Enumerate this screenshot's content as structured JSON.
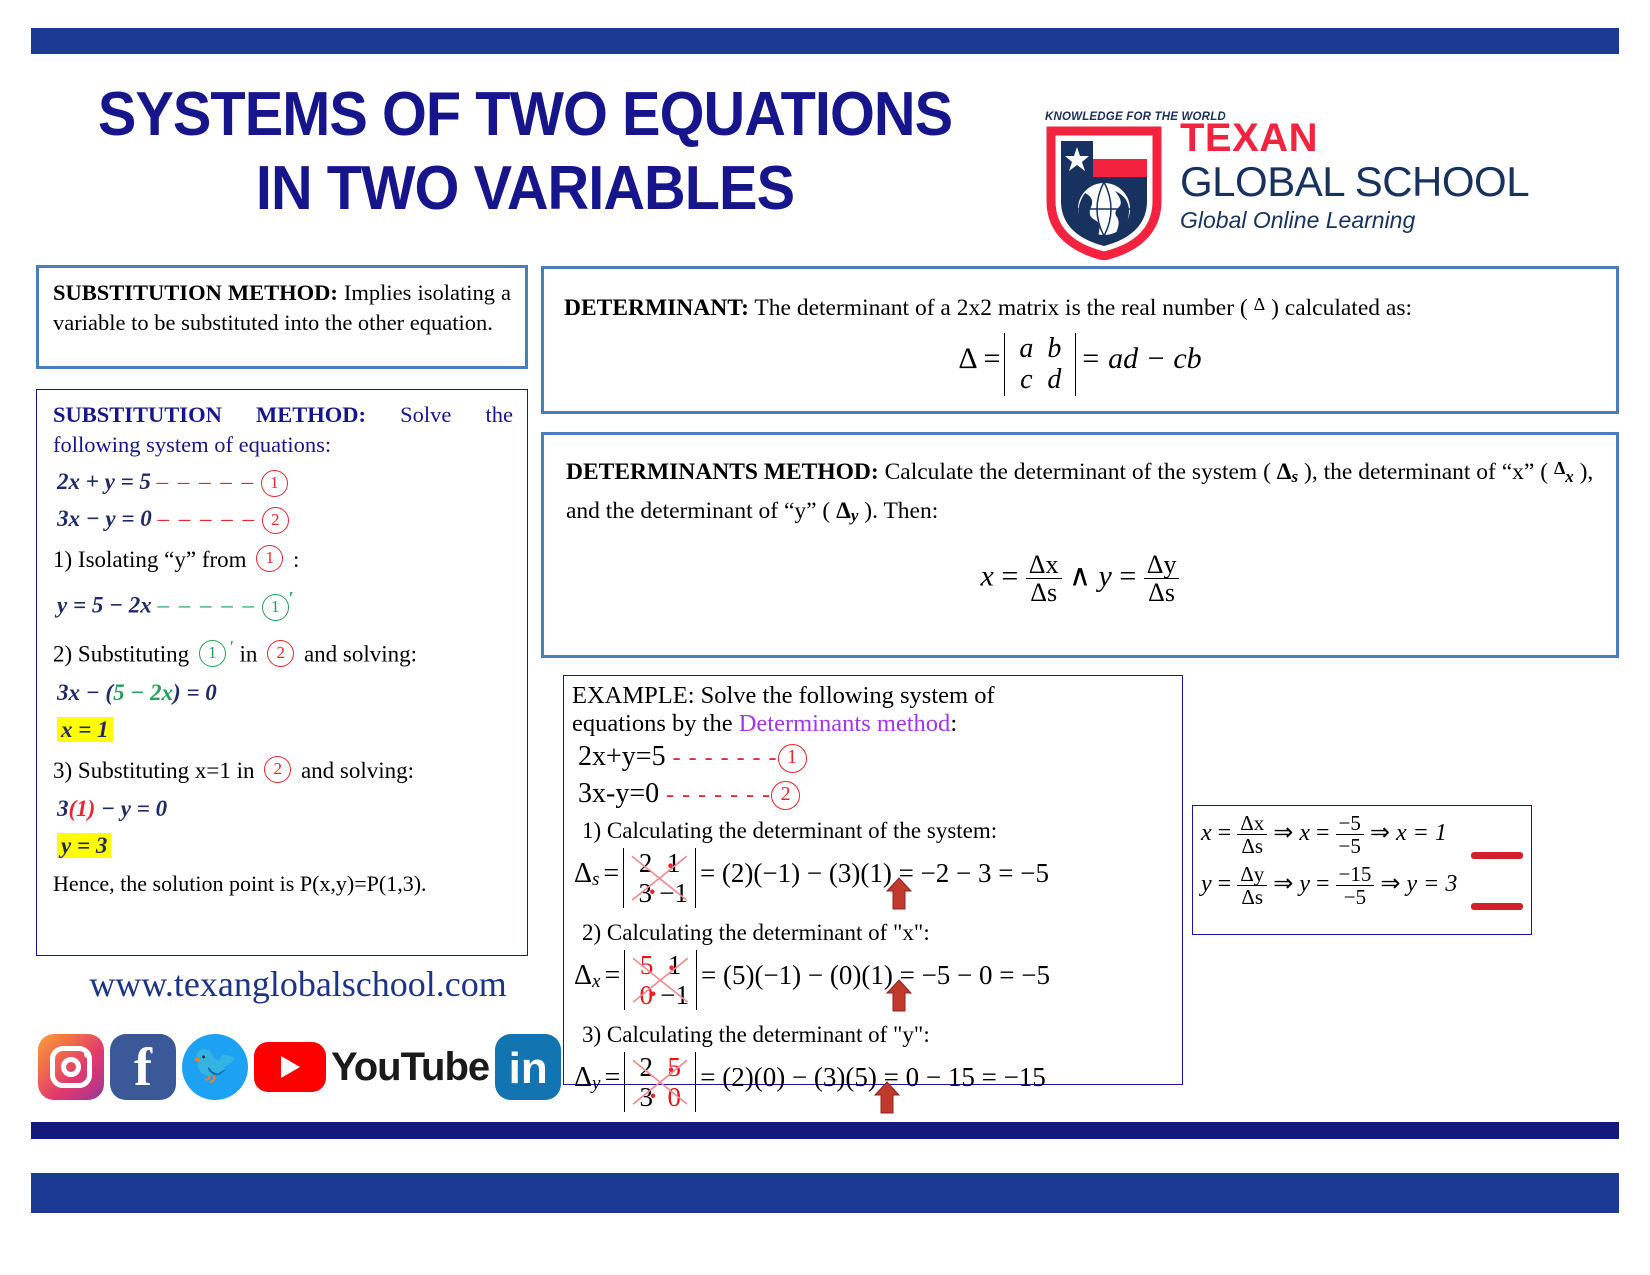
{
  "header": {
    "title_line1": "SYSTEMS OF TWO EQUATIONS",
    "title_line2": "IN TWO VARIABLES",
    "accent_navy": "#16158c",
    "accent_blue": "#1b3a93"
  },
  "logo": {
    "tagline": "KNOWLEDGE FOR THE WORLD",
    "name_top": "TEXAN",
    "name_bottom": "GLOBAL SCHOOL",
    "subtitle": "Global Online Learning",
    "red": "#f3233f",
    "navy": "#17325f"
  },
  "substitution_definition": {
    "label": "SUBSTITUTION METHOD:",
    "text": " Implies isolating a variable to be substituted into the other equation."
  },
  "substitution_example": {
    "label": "SUBSTITUTION METHOD:",
    "intro": " Solve the following system of equations:",
    "eq1_lhs": "2x + y = 5",
    "eq1_tag": "1",
    "eq2_lhs": "3x − y = 0",
    "eq2_tag": "2",
    "step1": "1) Isolating “y” from",
    "step1_tag": "1",
    "step1_suffix": ":",
    "eq1p_lhs": "y = 5 − 2x",
    "eq1p_tag": "1",
    "eq1p_prime": "′",
    "step2_a": "2) Substituting",
    "step2_tag1": "1",
    "step2_mid": "in",
    "step2_tag2": "2",
    "step2_b": "and solving:",
    "eq_sub": "3x − (5 − 2x) = 0",
    "eq_sub_paren": "5 − 2x",
    "result_x": "x = 1",
    "step3_a": "3) Substituting x=1 in",
    "step3_tag": "2",
    "step3_b": "and solving:",
    "eq_sub2_pre": "3",
    "eq_sub2_red": "(1)",
    "eq_sub2_post": " − y = 0",
    "result_y": "y = 3",
    "conclusion": "Hence, the solution point is P(x,y)=P(1,3).",
    "highlight_color": "#ffff00"
  },
  "footer": {
    "website": "www.texanglobalschool.com",
    "socials": [
      {
        "name": "instagram-icon",
        "label": ""
      },
      {
        "name": "facebook-icon",
        "label": "f"
      },
      {
        "name": "twitter-icon",
        "label": ""
      },
      {
        "name": "youtube-icon",
        "label": "YouTube"
      },
      {
        "name": "linkedin-icon",
        "label": "in"
      }
    ]
  },
  "determinant_definition": {
    "label": "DETERMINANT:",
    "text_a": " The determinant of a 2x2 matrix is the real number ( ",
    "symbol": "Δ",
    "text_b": " ) calculated as:",
    "formula_lhs": "Δ =",
    "matrix": [
      [
        "a",
        "b"
      ],
      [
        "c",
        "d"
      ]
    ],
    "formula_rhs": "= ad − cb"
  },
  "determinants_method": {
    "label": "DETERMINANTS METHOD:",
    "text_a": " Calculate the determinant of the system ( ",
    "sym_s": "Δ",
    "sub_s": "s",
    "text_b": " ),  the determinant of “x” ( ",
    "sym_x": "Δ",
    "sub_x": "x",
    "text_c": " ), and the determinant of “y” ( ",
    "sym_y": "Δ",
    "sub_y": "y",
    "text_d": " ). Then:",
    "formula_x_var": "x",
    "formula_num_x": "Δx",
    "formula_den": "Δs",
    "conj": "∧",
    "formula_y_var": "y",
    "formula_num_y": "Δy"
  },
  "example": {
    "head_a": "EXAMPLE: Solve the following system of",
    "head_b": "equations by the ",
    "head_highlight": "Determinants method",
    "head_c": ":",
    "highlight_color": "#a335ee",
    "eq1": "2x+y=5",
    "eq1_tag": "1",
    "eq2": "3x-y=0",
    "eq2_tag": "2",
    "step1": "1) Calculating the determinant of the system:",
    "ds_label": "Δ",
    "ds_sub": "s",
    "ds_matrix": [
      [
        "2",
        "1"
      ],
      [
        "3",
        "−1"
      ]
    ],
    "ds_expr": "= (2)(−1) − (3)(1) = −2 − 3 = −5",
    "step2": "2) Calculating the determinant of \"x\":",
    "dx_label": "Δ",
    "dx_sub": "x",
    "dx_matrix": [
      [
        "5",
        "1"
      ],
      [
        "0",
        "−1"
      ]
    ],
    "dx_red_cells": [
      "5",
      "0"
    ],
    "dx_expr": "= (5)(−1) − (0)(1) = −5 − 0 = −5",
    "step3": "3) Calculating the determinant of \"y\":",
    "dy_label": "Δ",
    "dy_sub": "y",
    "dy_matrix": [
      [
        "2",
        "5"
      ],
      [
        "3",
        "0"
      ]
    ],
    "dy_red_cells": [
      "5",
      "0"
    ],
    "dy_expr": "= (2)(0) − (3)(5) = 0 − 15 = −15",
    "arrow_color": "#c0392b"
  },
  "result": {
    "x_var": "x",
    "x_num": "Δx",
    "x_den": "Δs",
    "arrow": "⇒",
    "x_num_val": "−5",
    "x_den_val": "−5",
    "x_result": "x = 1",
    "y_var": "y",
    "y_num": "Δy",
    "y_den": "Δs",
    "y_num_val": "−15",
    "y_den_val": "−5",
    "y_result": "y = 3",
    "underline_color": "#d32029"
  }
}
